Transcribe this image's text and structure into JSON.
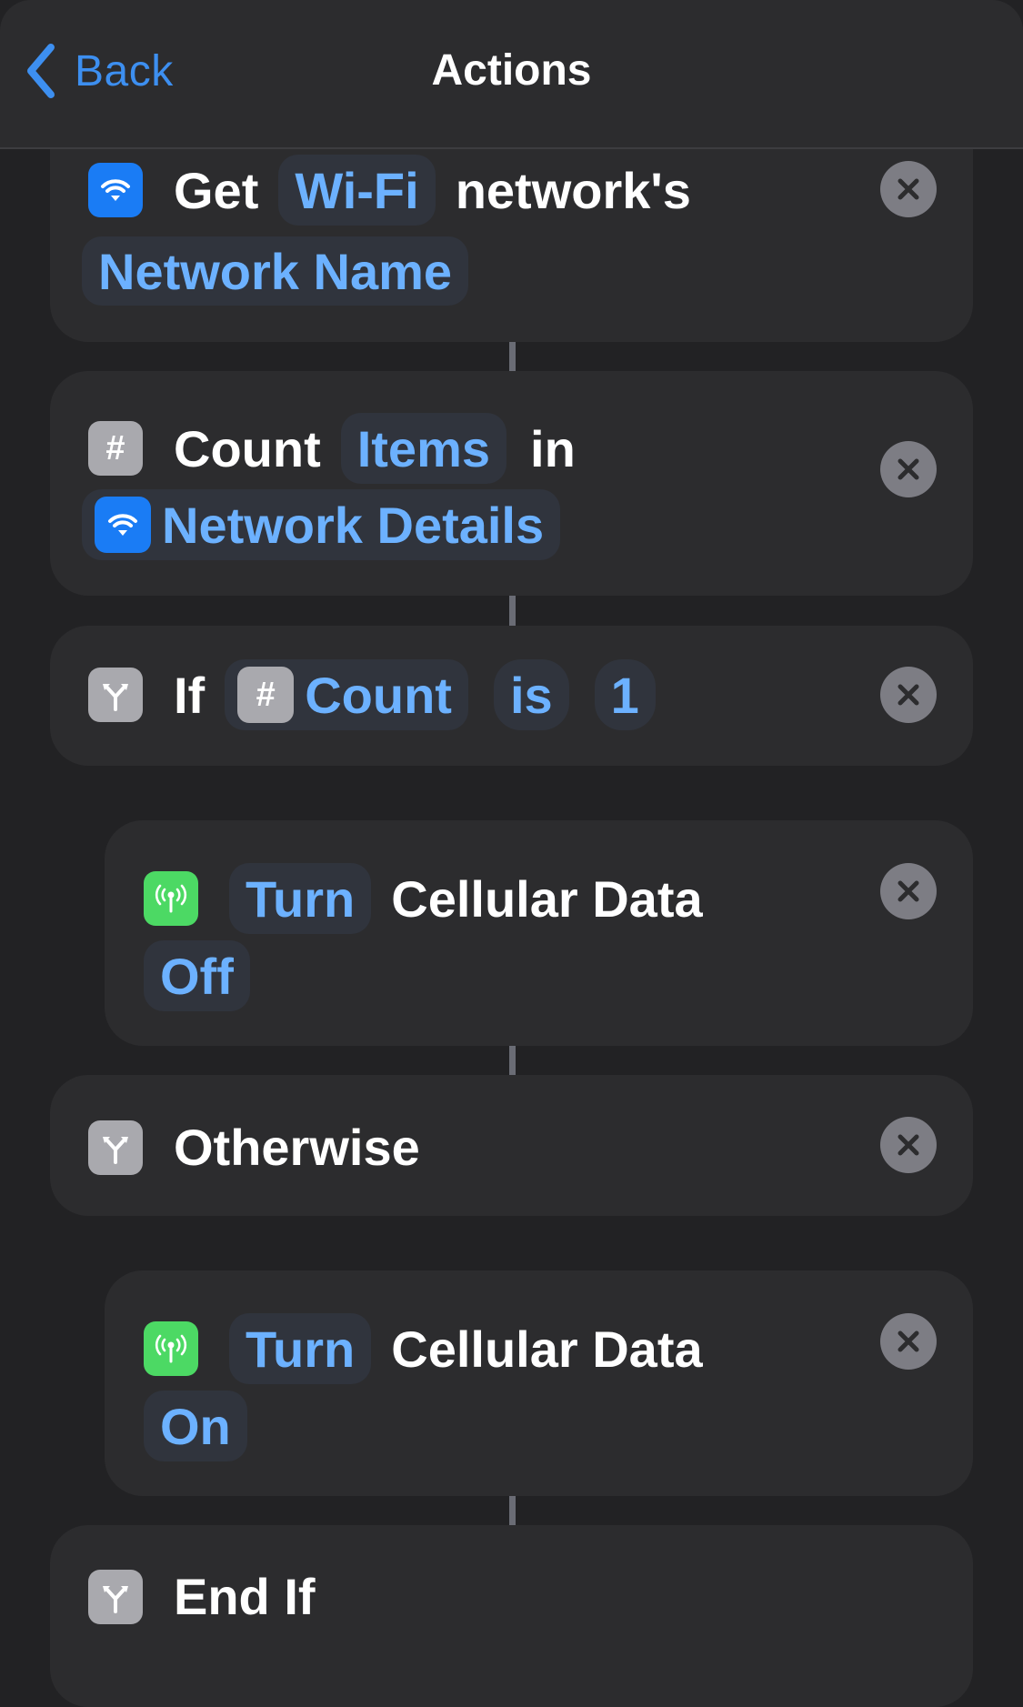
{
  "nav": {
    "back_label": "Back",
    "title": "Actions"
  },
  "colors": {
    "accent": "#3d8ff0",
    "token_text": "#6cb1ff",
    "background": "#222224",
    "card": "#2c2c2e",
    "token_bg": "#30343d",
    "wifi_icon_bg": "#1a7cf5",
    "scripting_icon_bg": "#a9a9ae",
    "cellular_icon_bg": "#4cd964",
    "close_button": "#7d7d84"
  },
  "actions": [
    {
      "id": "get-wifi",
      "icon": "wifi-icon",
      "verb": "Get",
      "param1": "Wi-Fi",
      "suffix": "network's",
      "param2": "Network Name"
    },
    {
      "id": "count",
      "icon": "hash-icon",
      "verb": "Count",
      "param1": "Items",
      "suffix": "in",
      "variable": "Network Details",
      "variable_icon": "wifi-icon"
    },
    {
      "id": "if",
      "icon": "branch-icon",
      "verb": "If",
      "variable": "Count",
      "variable_icon": "hash-icon",
      "condition": "is",
      "value": "1"
    },
    {
      "id": "cellular-off",
      "icon": "cellular-antenna-icon",
      "param1": "Turn",
      "label": "Cellular Data",
      "param2": "Off"
    },
    {
      "id": "otherwise",
      "icon": "branch-icon",
      "label": "Otherwise"
    },
    {
      "id": "cellular-on",
      "icon": "cellular-antenna-icon",
      "param1": "Turn",
      "label": "Cellular Data",
      "param2": "On"
    },
    {
      "id": "end-if",
      "icon": "branch-icon",
      "label": "End If"
    }
  ],
  "icons": {
    "hash_glyph": "#"
  }
}
